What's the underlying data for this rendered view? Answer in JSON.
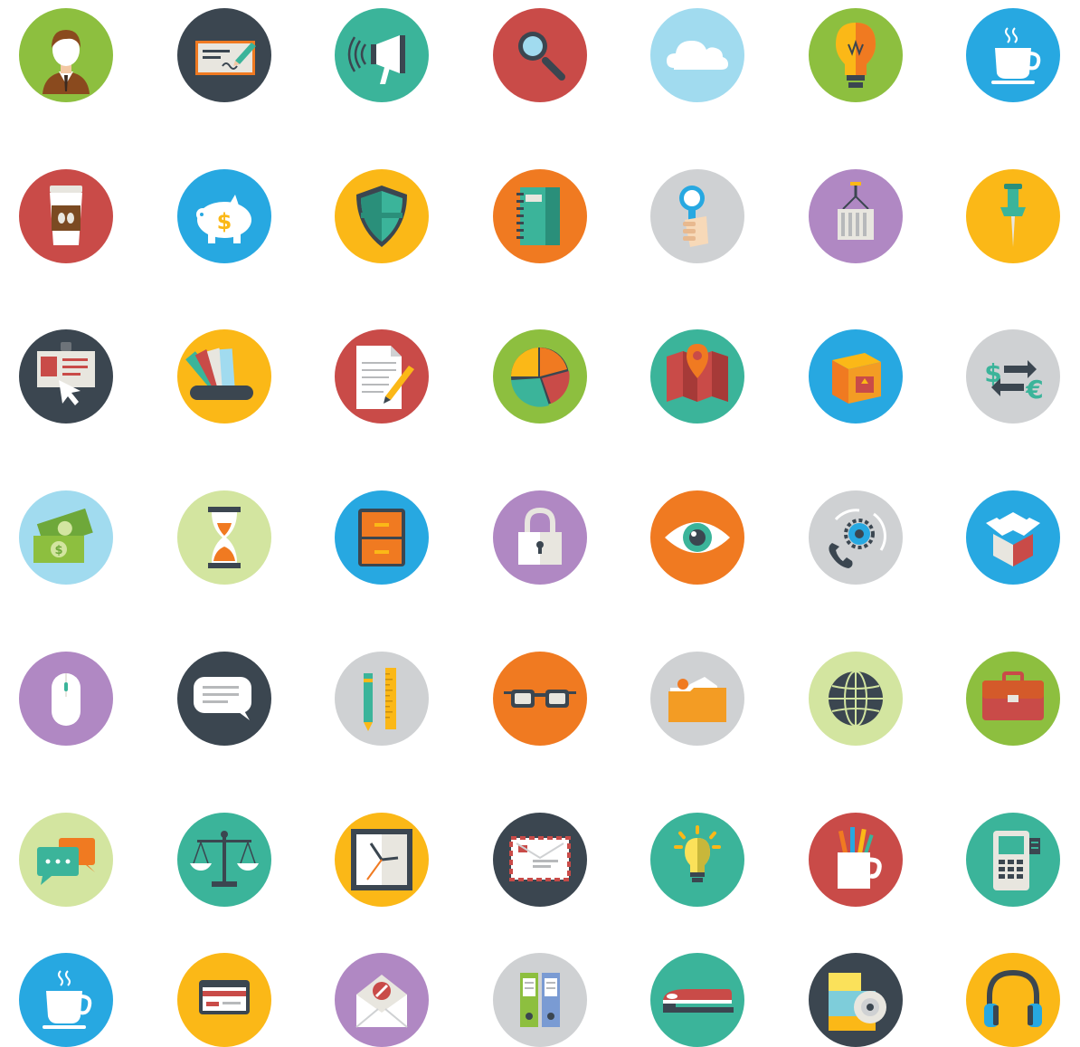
{
  "colors": {
    "green": "#8dbf3f",
    "dark": "#3b4650",
    "teal": "#3bb49a",
    "red": "#c94b48",
    "lightblue": "#a1dbef",
    "blue": "#27a8e1",
    "yellow": "#fbb817",
    "orange": "#f07a21",
    "gray": "#cfd1d3",
    "purple": "#b088c3",
    "palegreen": "#d3e5a0"
  },
  "icons": [
    {
      "name": "businessman-icon",
      "bg": "green"
    },
    {
      "name": "signed-check-icon",
      "bg": "dark"
    },
    {
      "name": "megaphone-icon",
      "bg": "teal"
    },
    {
      "name": "magnifier-icon",
      "bg": "red"
    },
    {
      "name": "cloud-icon",
      "bg": "lightblue"
    },
    {
      "name": "light-bulb-icon",
      "bg": "green"
    },
    {
      "name": "coffee-cup-icon",
      "bg": "blue"
    },
    {
      "name": "takeaway-coffee-icon",
      "bg": "red"
    },
    {
      "name": "piggy-bank-icon",
      "bg": "blue"
    },
    {
      "name": "shield-icon",
      "bg": "yellow"
    },
    {
      "name": "notebook-icon",
      "bg": "orange"
    },
    {
      "name": "hand-magnifier-icon",
      "bg": "gray"
    },
    {
      "name": "cargo-container-icon",
      "bg": "purple"
    },
    {
      "name": "push-pin-icon",
      "bg": "yellow"
    },
    {
      "name": "id-badge-click-icon",
      "bg": "dark"
    },
    {
      "name": "color-swatches-icon",
      "bg": "yellow"
    },
    {
      "name": "document-pencil-icon",
      "bg": "red"
    },
    {
      "name": "pie-chart-icon",
      "bg": "green"
    },
    {
      "name": "map-pin-icon",
      "bg": "teal"
    },
    {
      "name": "package-box-icon",
      "bg": "blue"
    },
    {
      "name": "currency-exchange-icon",
      "bg": "gray"
    },
    {
      "name": "banknotes-icon",
      "bg": "lightblue"
    },
    {
      "name": "hourglass-icon",
      "bg": "palegreen"
    },
    {
      "name": "filing-cabinet-icon",
      "bg": "blue"
    },
    {
      "name": "padlock-icon",
      "bg": "purple"
    },
    {
      "name": "eye-icon",
      "bg": "orange"
    },
    {
      "name": "phone-gear-icon",
      "bg": "gray"
    },
    {
      "name": "open-box-icon",
      "bg": "blue"
    },
    {
      "name": "computer-mouse-icon",
      "bg": "purple"
    },
    {
      "name": "speech-bubble-icon",
      "bg": "dark"
    },
    {
      "name": "pen-ruler-icon",
      "bg": "gray"
    },
    {
      "name": "glasses-icon",
      "bg": "orange"
    },
    {
      "name": "folder-icon",
      "bg": "gray"
    },
    {
      "name": "globe-icon",
      "bg": "palegreen"
    },
    {
      "name": "briefcase-icon",
      "bg": "green"
    },
    {
      "name": "chat-bubbles-icon",
      "bg": "palegreen"
    },
    {
      "name": "scales-icon",
      "bg": "teal"
    },
    {
      "name": "wall-clock-icon",
      "bg": "yellow"
    },
    {
      "name": "airmail-envelope-icon",
      "bg": "dark"
    },
    {
      "name": "idea-bulb-icon",
      "bg": "teal"
    },
    {
      "name": "pencil-cup-icon",
      "bg": "red"
    },
    {
      "name": "phone-fax-icon",
      "bg": "teal"
    },
    {
      "name": "hot-cup-icon",
      "bg": "blue"
    },
    {
      "name": "credit-card-icon",
      "bg": "yellow"
    },
    {
      "name": "mail-blocked-icon",
      "bg": "purple"
    },
    {
      "name": "binders-icon",
      "bg": "gray"
    },
    {
      "name": "stapler-icon",
      "bg": "teal"
    },
    {
      "name": "software-box-cd-icon",
      "bg": "dark"
    },
    {
      "name": "headphones-icon",
      "bg": "yellow"
    }
  ]
}
